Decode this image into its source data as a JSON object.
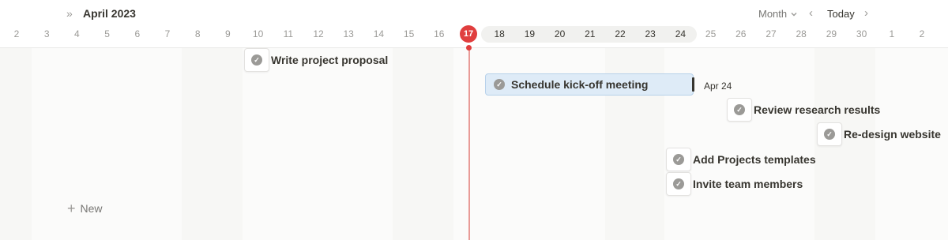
{
  "header": {
    "month_title": "April 2023",
    "view_label": "Month",
    "today_label": "Today"
  },
  "days": [
    "2",
    "3",
    "4",
    "5",
    "6",
    "7",
    "8",
    "9",
    "10",
    "11",
    "12",
    "13",
    "14",
    "15",
    "16",
    "17",
    "18",
    "19",
    "20",
    "21",
    "22",
    "23",
    "24",
    "25",
    "26",
    "27",
    "28",
    "29",
    "30",
    "1",
    "2"
  ],
  "today": "17",
  "tasks": [
    {
      "label": "Write project proposal"
    },
    {
      "label": "Schedule kick-off meeting",
      "end_date": "Apr 24"
    },
    {
      "label": "Review research results"
    },
    {
      "label": "Re-design website"
    },
    {
      "label": "Add Projects templates"
    },
    {
      "label": "Invite team members"
    }
  ],
  "new_label": "New",
  "icons": {
    "collapse": "double-chevron-right-icon",
    "dropdown": "chevron-down-icon",
    "prev": "chevron-left-icon",
    "next": "chevron-right-icon",
    "task": "check-circle-icon",
    "add": "plus-icon"
  },
  "colors": {
    "today_accent": "#e03e3e",
    "selected_task_bg": "#deebf7",
    "check_icon": "#9b9a97"
  }
}
